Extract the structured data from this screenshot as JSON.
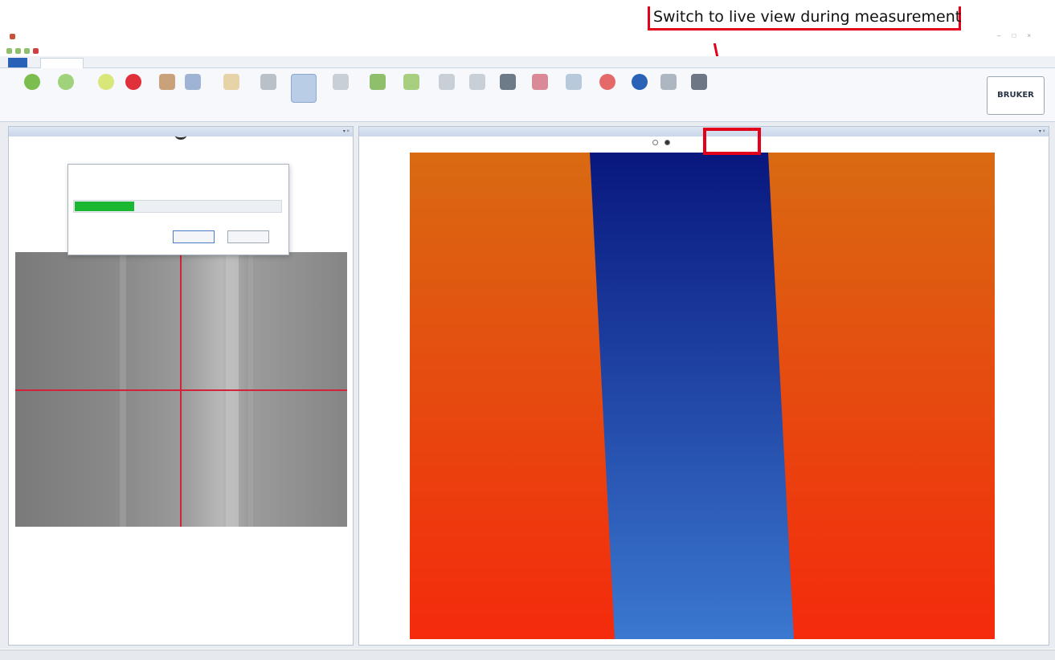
{
  "annotation": {
    "text": "Switch to live view during measurement",
    "color": "#e2001a"
  },
  "window": {
    "icon": "app-icon"
  },
  "ribbon": {
    "tabs": [
      {
        "icon": "file-tab"
      },
      {
        "active": true
      },
      {
        "active": false
      },
      {
        "active": false
      }
    ],
    "buttons": [
      {
        "icon": "start-icon",
        "color": "#7bbd4e"
      },
      {
        "icon": "measurement-icon",
        "color": "#9fd27a"
      },
      {
        "icon": "pause-icon",
        "color": "#d9e67a"
      },
      {
        "icon": "stop-icon",
        "color": "#e0303c"
      },
      {
        "icon": "tools-icon",
        "color": "#c9a27c"
      },
      {
        "icon": "tools-icon",
        "color": "#9fb4d4"
      },
      {
        "icon": "alignment-icon",
        "color": "#e6d3a8"
      },
      {
        "icon": "gear-icon",
        "color": "#b9c0c8"
      },
      {
        "icon": "live-view-icon",
        "color": "#b9cde6"
      },
      {
        "icon": "filter-icon",
        "color": "#c9cfd6"
      },
      {
        "icon": "grid-icon",
        "color": "#8fbf6a"
      },
      {
        "icon": "grid-icon",
        "color": "#a7cf7f"
      },
      {
        "icon": "scan-icon",
        "color": "#c9cfd6"
      },
      {
        "icon": "scan-icon",
        "color": "#c9cfd6"
      },
      {
        "icon": "pattern-icon",
        "color": "#6d7a88"
      },
      {
        "icon": "pattern-icon",
        "color": "#d98a96"
      },
      {
        "icon": "windows-icon",
        "color": "#b9c9dc"
      },
      {
        "icon": "reset-icon",
        "color": "#e46a6a"
      },
      {
        "icon": "help-icon",
        "color": "#2a62b8"
      },
      {
        "icon": "search-icon",
        "color": "#aeb6c2"
      },
      {
        "icon": "print-icon",
        "color": "#6d7684"
      }
    ]
  },
  "logo": {
    "text": "BRUKER"
  },
  "left_panel": {
    "icon": "eye-icon"
  },
  "dialog": {
    "progress_fraction": 0.29,
    "progress_color": "#1ab832"
  },
  "right_panel": {
    "view_options": [
      {
        "selected": false
      },
      {
        "selected": true
      }
    ]
  },
  "colors": {
    "orange_top": "#d96a12",
    "red_bottom": "#f42a0c",
    "blue_top": "#08177e",
    "blue_bottom": "#3b78cf",
    "crosshair": "#d3223a"
  }
}
